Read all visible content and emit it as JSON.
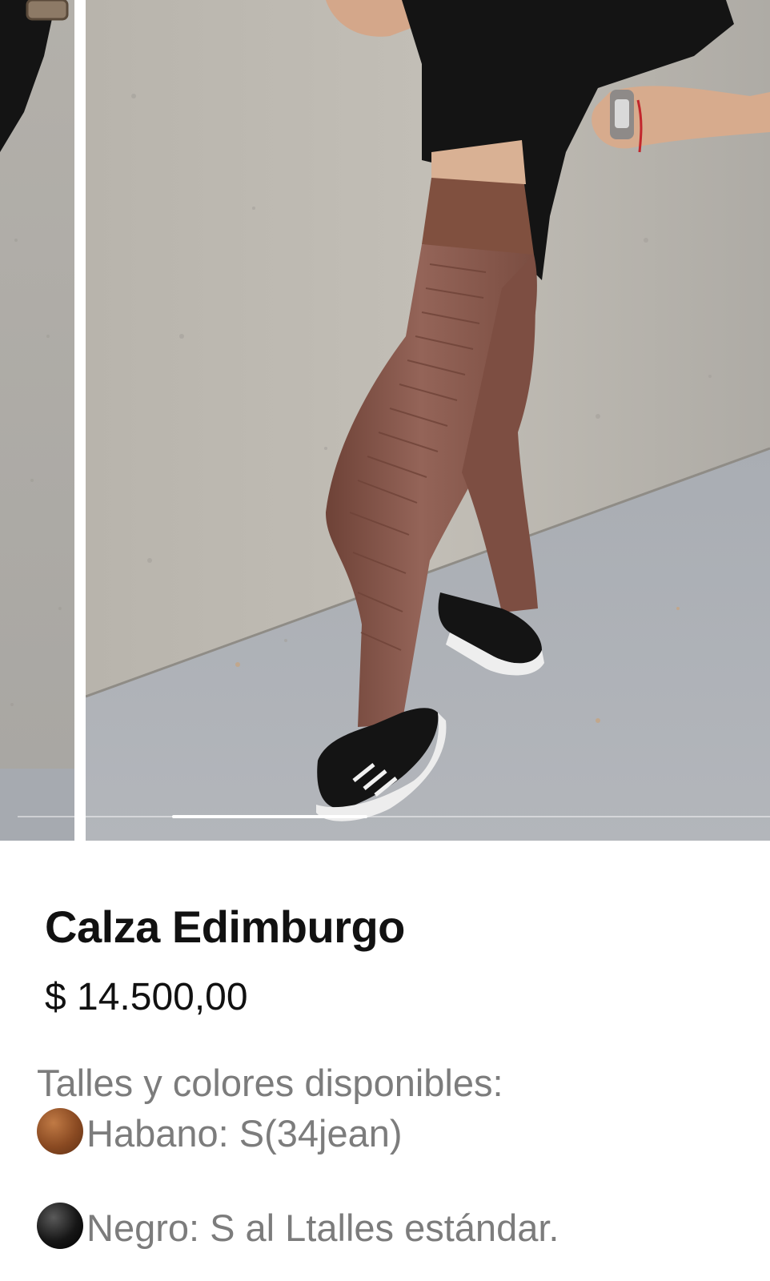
{
  "gallery": {
    "current_image": "brown high-waist leggings with ribbed side panel, black t-shirt, black sneakers, against a concrete wall",
    "previous_image": "partial view of previous photo",
    "progress_fraction": 0.26
  },
  "product": {
    "title": "Calza Edimburgo",
    "price": "$ 14.500,00",
    "description": {
      "heading": "Talles y colores disponibles:",
      "options": [
        {
          "icon": "brown-circle-icon",
          "color": "#8a4a22",
          "text": "Habano: S(34jean)"
        },
        {
          "icon": "black-circle-icon",
          "color": "#111111",
          "text": "Negro: S al Ltalles estándar."
        }
      ]
    }
  },
  "colors": {
    "title_text": "#111111",
    "description_text": "#7c7c7c",
    "legging_brown": "#8c5d50",
    "wall_gray": "#b9b5ad"
  }
}
